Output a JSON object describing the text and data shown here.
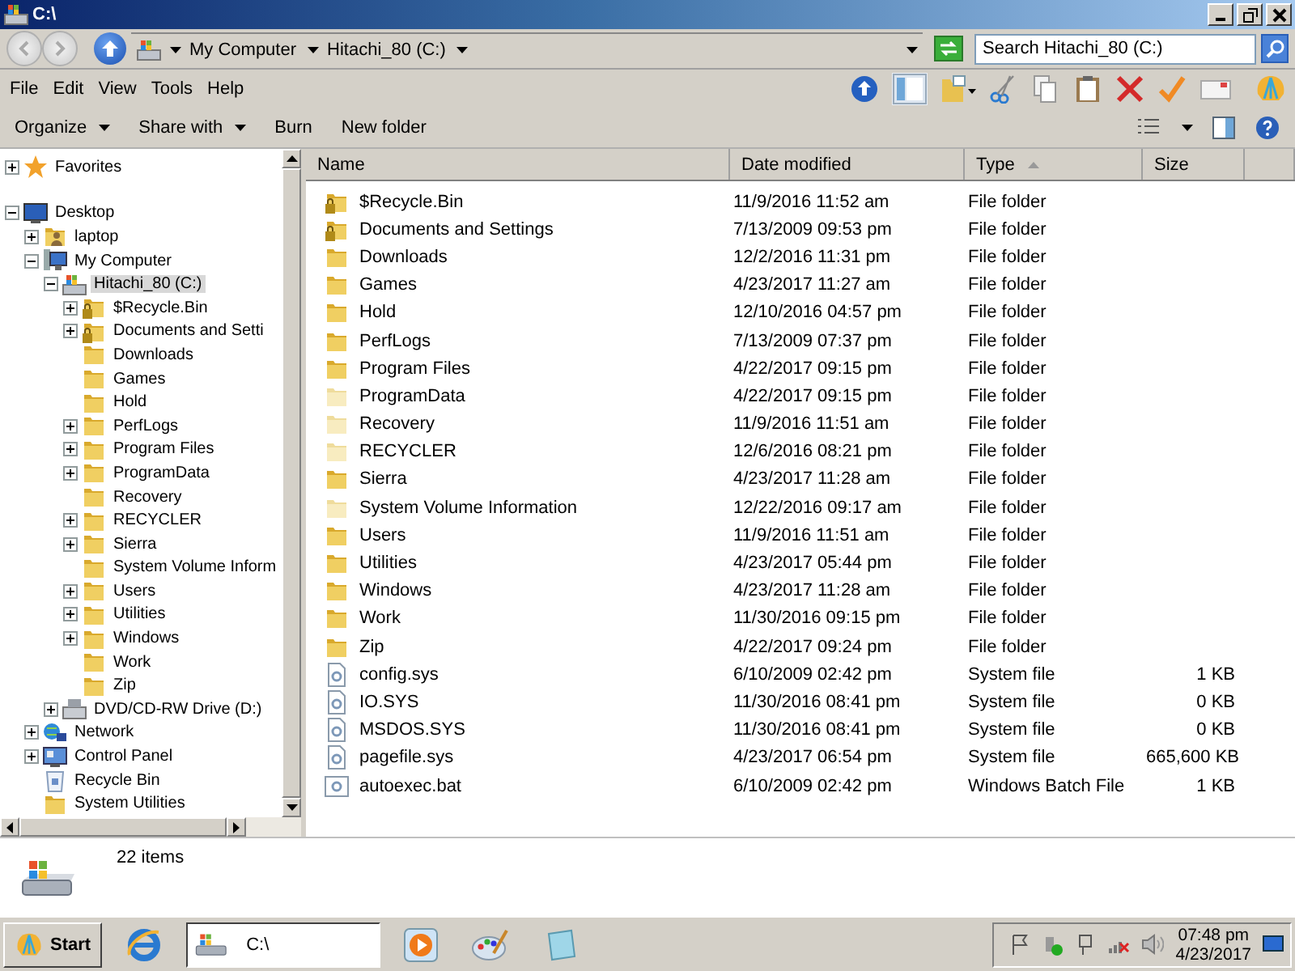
{
  "window": {
    "title": "C:\\"
  },
  "address": {
    "crumbs": [
      "My Computer",
      "Hitachi_80 (C:)"
    ]
  },
  "search": {
    "placeholder": "Search Hitachi_80 (C:)"
  },
  "menu": [
    "File",
    "Edit",
    "View",
    "Tools",
    "Help"
  ],
  "commands": [
    {
      "label": "Organize",
      "dropdown": true
    },
    {
      "label": "Share with",
      "dropdown": true
    },
    {
      "label": "Burn",
      "dropdown": false
    },
    {
      "label": "New folder",
      "dropdown": false
    }
  ],
  "tree": [
    {
      "label": "Favorites",
      "kind": "star",
      "expandable": true,
      "expanded": false,
      "selected": false
    },
    {
      "label": "Desktop",
      "kind": "desktop",
      "expandable": true,
      "expanded": true,
      "selected": false,
      "children": [
        {
          "label": "laptop",
          "kind": "user-folder",
          "expandable": true,
          "expanded": false,
          "selected": false
        },
        {
          "label": "My Computer",
          "kind": "computer",
          "expandable": true,
          "expanded": true,
          "selected": false,
          "children": [
            {
              "label": "Hitachi_80 (C:)",
              "kind": "drive",
              "expandable": true,
              "expanded": true,
              "selected": true,
              "children": [
                {
                  "label": "$Recycle.Bin",
                  "kind": "locked-folder",
                  "expandable": true,
                  "expanded": false,
                  "selected": false
                },
                {
                  "label": "Documents and Setti",
                  "kind": "locked-folder",
                  "expandable": true,
                  "expanded": false,
                  "selected": false
                },
                {
                  "label": "Downloads",
                  "kind": "folder",
                  "expandable": false,
                  "selected": false
                },
                {
                  "label": "Games",
                  "kind": "folder",
                  "expandable": false,
                  "selected": false
                },
                {
                  "label": "Hold",
                  "kind": "folder",
                  "expandable": false,
                  "selected": false
                },
                {
                  "label": "PerfLogs",
                  "kind": "folder",
                  "expandable": true,
                  "expanded": false,
                  "selected": false
                },
                {
                  "label": "Program Files",
                  "kind": "folder",
                  "expandable": true,
                  "expanded": false,
                  "selected": false
                },
                {
                  "label": "ProgramData",
                  "kind": "folder",
                  "expandable": true,
                  "expanded": false,
                  "selected": false
                },
                {
                  "label": "Recovery",
                  "kind": "folder",
                  "expandable": false,
                  "selected": false
                },
                {
                  "label": "RECYCLER",
                  "kind": "folder",
                  "expandable": true,
                  "expanded": false,
                  "selected": false
                },
                {
                  "label": "Sierra",
                  "kind": "folder",
                  "expandable": true,
                  "expanded": false,
                  "selected": false
                },
                {
                  "label": "System Volume Inform",
                  "kind": "folder",
                  "expandable": false,
                  "selected": false
                },
                {
                  "label": "Users",
                  "kind": "folder",
                  "expandable": true,
                  "expanded": false,
                  "selected": false
                },
                {
                  "label": "Utilities",
                  "kind": "folder",
                  "expandable": true,
                  "expanded": false,
                  "selected": false
                },
                {
                  "label": "Windows",
                  "kind": "folder",
                  "expandable": true,
                  "expanded": false,
                  "selected": false
                },
                {
                  "label": "Work",
                  "kind": "folder",
                  "expandable": false,
                  "selected": false
                },
                {
                  "label": "Zip",
                  "kind": "folder",
                  "expandable": false,
                  "selected": false
                }
              ]
            },
            {
              "label": "DVD/CD-RW Drive (D:)",
              "kind": "dvd",
              "expandable": true,
              "expanded": false,
              "selected": false
            }
          ]
        },
        {
          "label": "Network",
          "kind": "network",
          "expandable": true,
          "expanded": false,
          "selected": false
        },
        {
          "label": "Control Panel",
          "kind": "control-panel",
          "expandable": true,
          "expanded": false,
          "selected": false
        },
        {
          "label": "Recycle Bin",
          "kind": "recycle-bin",
          "expandable": false,
          "selected": false
        },
        {
          "label": "System Utilities",
          "kind": "folder",
          "expandable": false,
          "selected": false
        }
      ]
    }
  ],
  "columns": [
    {
      "label": "Name",
      "sorted": false
    },
    {
      "label": "Date modified",
      "sorted": false
    },
    {
      "label": "Type",
      "sorted": true
    },
    {
      "label": "Size",
      "sorted": false
    }
  ],
  "files": [
    {
      "name": "$Recycle.Bin",
      "date": "11/9/2016 11:52 am",
      "type": "File folder",
      "kind": "locked-folder"
    },
    {
      "name": "Documents and Settings",
      "date": "7/13/2009 09:53 pm",
      "type": "File folder",
      "kind": "locked-folder"
    },
    {
      "name": "Downloads",
      "date": "12/2/2016 11:31 pm",
      "type": "File folder",
      "kind": "folder"
    },
    {
      "name": "Games",
      "date": "4/23/2017 11:27 am",
      "type": "File folder",
      "kind": "folder"
    },
    {
      "name": "Hold",
      "date": "12/10/2016 04:57 pm",
      "type": "File folder",
      "kind": "folder"
    },
    {
      "name": "PerfLogs",
      "date": "7/13/2009 07:37 pm",
      "type": "File folder",
      "kind": "folder"
    },
    {
      "name": "Program Files",
      "date": "4/22/2017 09:15 pm",
      "type": "File folder",
      "kind": "folder"
    },
    {
      "name": "ProgramData",
      "date": "4/22/2017 09:15 pm",
      "type": "File folder",
      "kind": "hidden-folder"
    },
    {
      "name": "Recovery",
      "date": "11/9/2016 11:51 am",
      "type": "File folder",
      "kind": "hidden-folder"
    },
    {
      "name": "RECYCLER",
      "date": "12/6/2016 08:21 pm",
      "type": "File folder",
      "kind": "hidden-folder"
    },
    {
      "name": "Sierra",
      "date": "4/23/2017 11:28 am",
      "type": "File folder",
      "kind": "folder"
    },
    {
      "name": "System Volume Information",
      "date": "12/22/2016 09:17 am",
      "type": "File folder",
      "kind": "hidden-folder"
    },
    {
      "name": "Users",
      "date": "11/9/2016 11:51 am",
      "type": "File folder",
      "kind": "folder"
    },
    {
      "name": "Utilities",
      "date": "4/23/2017 05:44 pm",
      "type": "File folder",
      "kind": "folder"
    },
    {
      "name": "Windows",
      "date": "4/23/2017 11:28 am",
      "type": "File folder",
      "kind": "folder"
    },
    {
      "name": "Work",
      "date": "11/30/2016 09:15 pm",
      "type": "File folder",
      "kind": "folder"
    },
    {
      "name": "Zip",
      "date": "4/22/2017 09:24 pm",
      "type": "File folder",
      "kind": "folder"
    },
    {
      "name": "config.sys",
      "date": "6/10/2009 02:42 pm",
      "type": "System file",
      "size": "1 KB",
      "kind": "file"
    },
    {
      "name": "IO.SYS",
      "date": "11/30/2016 08:41 pm",
      "type": "System file",
      "size": "0 KB",
      "kind": "file"
    },
    {
      "name": "MSDOS.SYS",
      "date": "11/30/2016 08:41 pm",
      "type": "System file",
      "size": "0 KB",
      "kind": "file"
    },
    {
      "name": "pagefile.sys",
      "date": "4/23/2017 06:54 pm",
      "type": "System file",
      "size": "665,600 KB",
      "kind": "file"
    },
    {
      "name": "autoexec.bat",
      "date": "6/10/2009 02:42 pm",
      "type": "Windows Batch File",
      "size": "1 KB",
      "kind": "batch-file"
    }
  ],
  "details": {
    "count": "22 items"
  },
  "taskbar": {
    "start": "Start",
    "windows": [
      {
        "label": "C:\\",
        "selected": true
      }
    ],
    "clock": {
      "time": "07:48 pm",
      "date": "4/23/2017"
    }
  }
}
